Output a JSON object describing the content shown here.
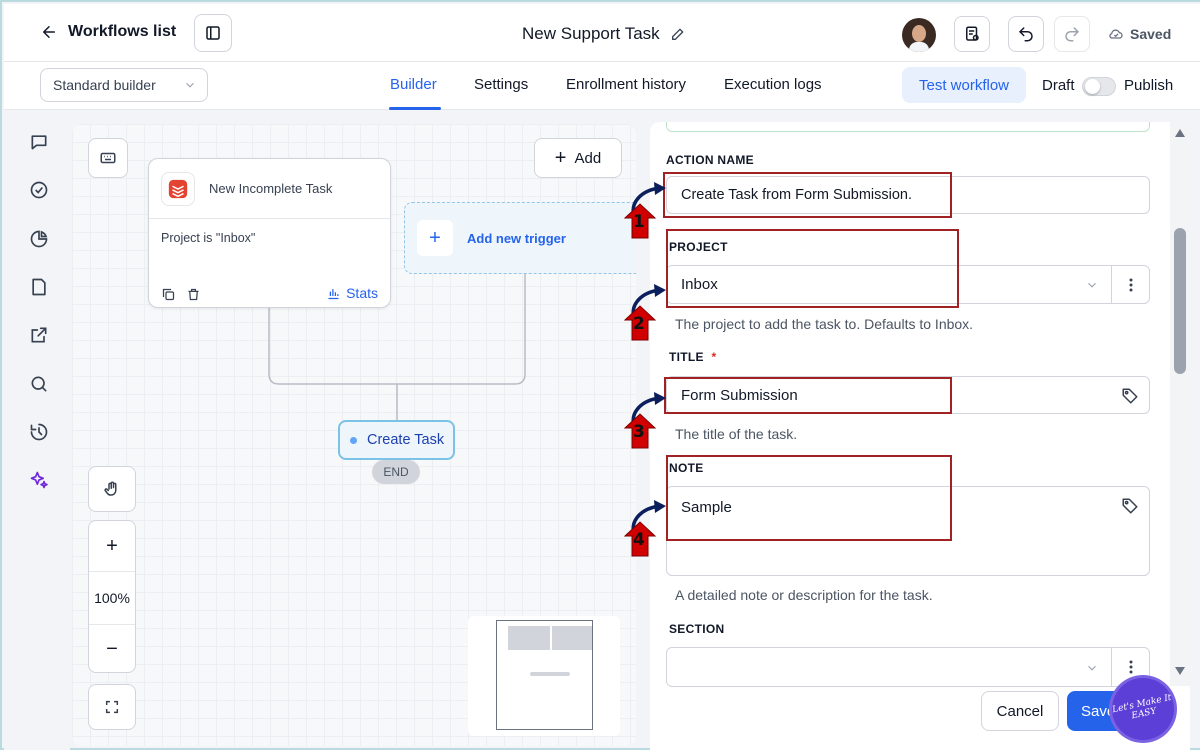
{
  "header": {
    "back_label": "Workflows list",
    "title": "New Support Task",
    "saved_label": "Saved"
  },
  "subbar": {
    "builder_select": "Standard builder",
    "tabs": [
      {
        "label": "Builder",
        "active": true
      },
      {
        "label": "Settings",
        "active": false
      },
      {
        "label": "Enrollment history",
        "active": false
      },
      {
        "label": "Execution logs",
        "active": false
      }
    ],
    "test_workflow": "Test workflow",
    "draft": "Draft",
    "publish": "Publish",
    "publish_enabled": false
  },
  "sidebar": {
    "icons": [
      "chat-icon",
      "check-circle-icon",
      "pie-chart-icon",
      "document-icon",
      "external-link-icon",
      "search-icon",
      "history-icon",
      "sparkles-icon"
    ]
  },
  "canvas": {
    "add_label": "Add",
    "trigger": {
      "name": "New Incomplete Task",
      "condition": "Project is \"Inbox\"",
      "stats_label": "Stats"
    },
    "add_trigger_label": "Add new trigger",
    "action_node": "Create Task",
    "end_node": "END",
    "zoom_level": "100%",
    "zoom_in": "+",
    "zoom_out": "−"
  },
  "panel": {
    "action_name": {
      "label": "ACTION NAME",
      "value": "Create Task from Form Submission."
    },
    "project": {
      "label": "PROJECT",
      "value": "Inbox",
      "help": "The project to add the task to. Defaults to Inbox."
    },
    "title": {
      "label": "TITLE",
      "required_mark": "*",
      "value": "Form Submission",
      "help": "The title of the task."
    },
    "note": {
      "label": "NOTE",
      "value": "Sample",
      "help": "A detailed note or description for the task."
    },
    "section": {
      "label": "SECTION",
      "value": ""
    },
    "cancel": "Cancel",
    "save": "Save"
  },
  "annotations": {
    "markers": [
      "1",
      "2",
      "3",
      "4"
    ],
    "highlight_color": "#a12225",
    "marker_color": "#d10000"
  },
  "watermark": {
    "text": "Let's Make It EASY"
  },
  "colors": {
    "accent": "#2563eb",
    "canvas_bg": "#f7f8fa"
  }
}
